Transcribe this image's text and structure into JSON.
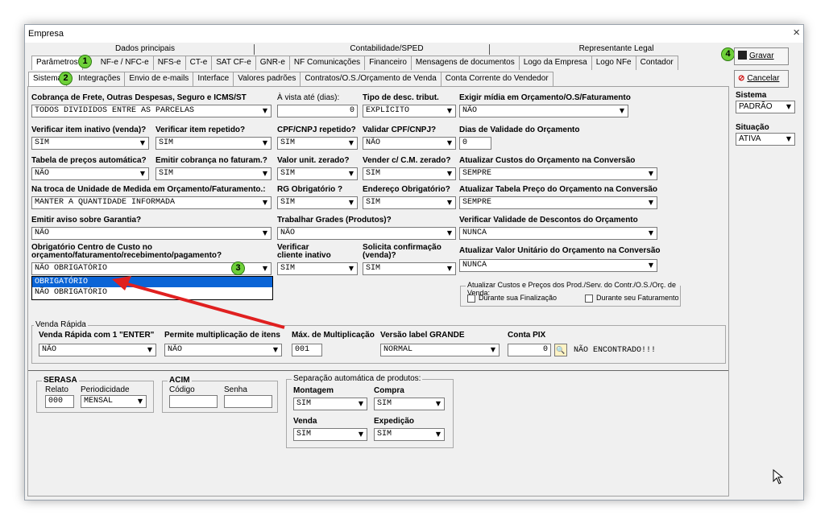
{
  "window": {
    "title": "Empresa",
    "close": "×"
  },
  "tabs_top": [
    "Dados principais",
    "Contabilidade/SPED",
    "Representante Legal"
  ],
  "tabs_row2": [
    "Parâmetros",
    "NF-e / NFC-e",
    "NFS-e",
    "CT-e",
    "SAT CF-e",
    "GNR-e",
    "NF Comunicações",
    "Financeiro",
    "Mensagens de documentos",
    "Logo da Empresa",
    "Logo NFe",
    "Contador"
  ],
  "tabs_row3": [
    "Sistema",
    "Integrações",
    "Envio de e-mails",
    "Interface",
    "Valores padrões",
    "Contratos/O.S./Orçamento de Venda",
    "Conta Corrente do Vendedor"
  ],
  "badges": [
    "1",
    "2",
    "3",
    "4"
  ],
  "fields": {
    "cobranca_frete": {
      "label": "Cobrança de Frete, Outras Despesas, Seguro e ICMS/ST",
      "value": "TODOS DIVIDIDOS ENTRE AS PARCELAS"
    },
    "a_vista": {
      "label": "À vista até (dias):",
      "value": "0"
    },
    "tipo_desc": {
      "label": "Tipo de desc. tribut.",
      "value": "EXPLÍCITO"
    },
    "exigir_midia": {
      "label": "Exigir mídia em Orçamento/O.S/Faturamento",
      "value": "NÃO"
    },
    "verif_inativo": {
      "label": "Verificar item inativo (venda)?",
      "value": "SIM"
    },
    "verif_repetido": {
      "label": "Verificar item repetido?",
      "value": "SIM"
    },
    "cpf_repetido": {
      "label": "CPF/CNPJ repetido?",
      "value": "SIM"
    },
    "validar_cpf": {
      "label": "Validar CPF/CNPJ?",
      "value": "NÃO"
    },
    "dias_validade": {
      "label": "Dias de Validade do Orçamento",
      "value": "0"
    },
    "tabela_auto": {
      "label": "Tabela de preços automática?",
      "value": "NÃO"
    },
    "emitir_cobranca": {
      "label": "Emitir cobrança no faturam.?",
      "value": "SIM"
    },
    "valor_zerado": {
      "label": "Valor unit. zerado?",
      "value": "SIM"
    },
    "vender_cm": {
      "label": "Vender c/ C.M. zerado?",
      "value": "SIM"
    },
    "atualizar_custos": {
      "label": "Atualizar Custos do Orçamento na Conversão",
      "value": "SEMPRE"
    },
    "troca_unidade": {
      "label": "Na troca de Unidade de Medida em Orçamento/Faturamento.:",
      "value": "MANTER A QUANTIDADE INFORMADA"
    },
    "rg_obrig": {
      "label": "RG Obrigatório ?",
      "value": "SIM"
    },
    "endereco_obrig": {
      "label": "Endereço Obrigatório?",
      "value": "SIM"
    },
    "atualizar_tabela": {
      "label": "Atualizar Tabela Preço do Orçamento na Conversão",
      "value": "SEMPRE"
    },
    "aviso_garantia": {
      "label": "Emitir aviso sobre Garantia?",
      "value": "NÃO"
    },
    "trabalhar_grades": {
      "label": "Trabalhar Grades (Produtos)?",
      "value": "NÃO"
    },
    "verif_descontos": {
      "label": "Verificar Validade de Descontos do Orçamento",
      "value": "NUNCA"
    },
    "centro_custo": {
      "label1": "Obrigatório Centro de Custo no",
      "label2": "orçamento/faturamento/recebimento/pagamento?",
      "value": "NÃO OBRIGATÓRIO"
    },
    "verif_cliente": {
      "label1": "Verificar",
      "label2": "cliente inativo",
      "value": "SIM"
    },
    "solicita_conf": {
      "label1": "Solicita confirmação",
      "label2": "(venda)?",
      "value": "SIM"
    },
    "atualizar_valor": {
      "label": "Atualizar Valor Unitário do Orçamento na Conversão",
      "value": "NUNCA"
    }
  },
  "dropdown_options": [
    "OBRIGATÓRIO",
    "NÃO OBRIGATÓRIO"
  ],
  "custos_group": {
    "title": "Atualizar Custos e Preços dos Prod./Serv. do Contr./O.S./Orç. de Venda:",
    "opt1": "Durante sua Finalização",
    "opt2": "Durante seu Faturamento"
  },
  "venda_rapida": {
    "title": "Venda Rápida",
    "enter_label": "Venda Rápida com 1 \"ENTER\"",
    "enter_value": "NÃO",
    "mult_label": "Permite multiplicação  de itens",
    "mult_value": "NÃO",
    "max_label": "Máx. de Multiplicação",
    "max_value": "001",
    "versao_label": "Versão label GRANDE",
    "versao_value": "NORMAL",
    "pix_label": "Conta PIX",
    "pix_value": "0",
    "pix_status": "NÃO ENCONTRADO!!!"
  },
  "serasa": {
    "title": "SERASA",
    "relato_label": "Relato",
    "relato_value": "000",
    "periodicidade_label": "Periodicidade",
    "periodicidade_value": "MENSAL"
  },
  "acim": {
    "title": "ACIM",
    "codigo_label": "Código",
    "senha_label": "Senha"
  },
  "separacao": {
    "title": "Separação automática de produtos:",
    "montagem_label": "Montagem",
    "montagem_value": "SIM",
    "compra_label": "Compra",
    "compra_value": "SIM",
    "venda_label": "Venda",
    "venda_value": "SIM",
    "expedicao_label": "Expedição",
    "expedicao_value": "SIM"
  },
  "right_panel": {
    "gravar": "Gravar",
    "cancelar": "Cancelar",
    "sistema_label": "Sistema",
    "sistema_value": "PADRÃO",
    "situacao_label": "Situação",
    "situacao_value": "ATIVA"
  },
  "colors": {
    "badge": "#6fd13a",
    "arrow": "#e02020",
    "selection": "#0a64d6",
    "cancel_icon": "#d01010"
  }
}
